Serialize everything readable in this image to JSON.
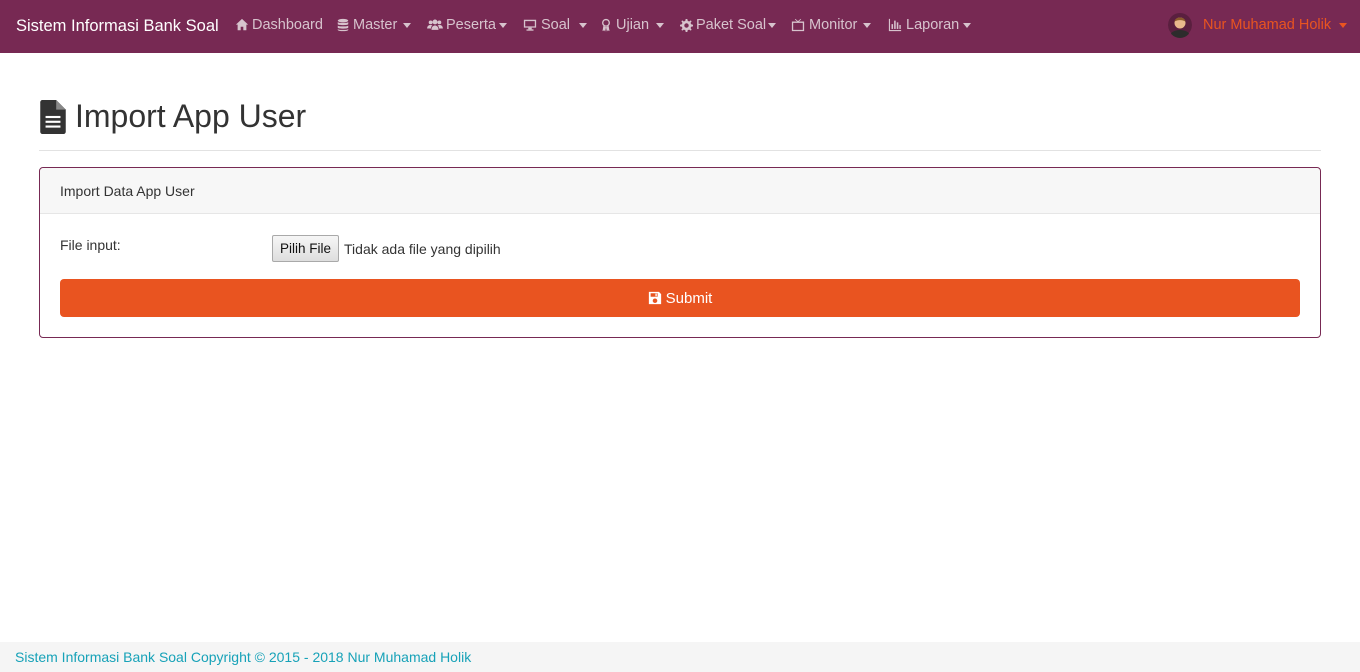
{
  "navbar": {
    "brand": "Sistem Informasi Bank Soal",
    "items": [
      {
        "label": "Dashboard",
        "icon": "home-icon",
        "dropdown": false
      },
      {
        "label": "Master",
        "icon": "database-icon",
        "dropdown": true
      },
      {
        "label": "Peserta",
        "icon": "users-icon",
        "dropdown": true
      },
      {
        "label": "Soal",
        "icon": "desktop-icon",
        "dropdown": true
      },
      {
        "label": "Ujian",
        "icon": "award-icon",
        "dropdown": true
      },
      {
        "label": "Paket Soal",
        "icon": "gear-icon",
        "dropdown": true
      },
      {
        "label": "Monitor",
        "icon": "tv-icon",
        "dropdown": true
      },
      {
        "label": "Laporan",
        "icon": "bar-chart-icon",
        "dropdown": true
      }
    ],
    "user": {
      "name": "Nur Muhamad Holik",
      "avatar_icon": "user-avatar"
    }
  },
  "page": {
    "title": "Import App User",
    "title_icon": "file-text-icon"
  },
  "card": {
    "header": "Import Data App User",
    "file_label": "File input:",
    "file_button": "Pilih File",
    "file_status": "Tidak ada file yang dipilih",
    "submit_label": "Submit",
    "submit_icon": "save-icon"
  },
  "footer": {
    "text": "Sistem Informasi Bank Soal Copyright © 2015 - 2018 Nur Muhamad Holik"
  },
  "colors": {
    "navbar": "#772953",
    "accent": "#e95420",
    "footer_text": "#17a2b8"
  }
}
